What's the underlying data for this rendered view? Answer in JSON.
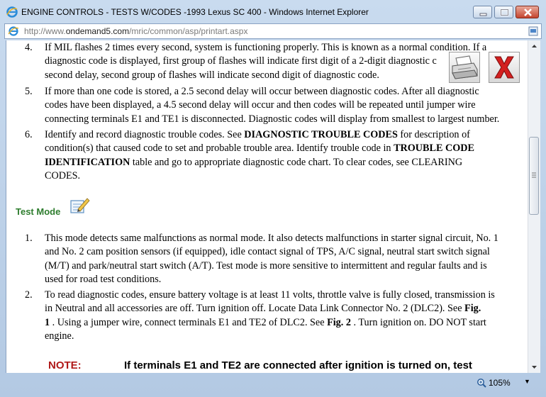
{
  "window": {
    "title": "ENGINE CONTROLS - TESTS W/CODES -1993 Lexus SC 400 - Windows Internet Explorer"
  },
  "address": {
    "prefix": "http://www.",
    "domain": "ondemand5.com",
    "path": "/mric/common/asp/printart.aspx"
  },
  "doc": {
    "items_top": [
      {
        "num": "4.",
        "lines": [
          "If MIL flashes 2 times every second, system is functioning properly. This is known as a normal condition. If a",
          "diagnostic code is displayed, first group of flashes will indicate first digit of a 2-digit diagnostic c",
          "second delay, second group of flashes will indicate second digit of diagnostic code."
        ]
      },
      {
        "num": "5.",
        "lines": [
          "If more than one code is stored, a 2.5 second delay will occur between diagnostic codes. After all diagnostic",
          "codes have been displayed, a 4.5 second delay will occur and then codes will be repeated until jumper wire",
          "connecting terminals E1 and TE1 is disconnected. Diagnostic codes will display from smallest to largest number."
        ]
      }
    ],
    "item6": {
      "num": "6.",
      "p1": "Identify and record diagnostic trouble codes. See ",
      "b1": "DIAGNOSTIC TROUBLE CODES",
      "p2": " for description of",
      "line2a": "condition(s) that caused code to set and probable trouble area. Identify trouble code in ",
      "b2": "TROUBLE CODE",
      "b3": "IDENTIFICATION",
      "line3": " table and go to appropriate diagnostic code chart. To clear codes, see CLEARING",
      "line4": "CODES."
    },
    "section_title": "Test Mode",
    "items_test": [
      {
        "num": "1.",
        "lines": [
          "This mode detects same malfunctions as normal mode. It also detects malfunctions in starter signal circuit, No. 1",
          "and No. 2 cam position sensors (if equipped), idle contact signal of TPS, A/C signal, neutral start switch signal",
          "(M/T) and park/neutral start switch (A/T). Test mode is more sensitive to intermittent and regular faults and is",
          "used for road test conditions."
        ]
      }
    ],
    "item2": {
      "num": "2.",
      "line1": "To read diagnostic codes, ensure battery voltage is at least 11 volts, throttle valve is fully closed, transmission is",
      "line2": "in Neutral and all accessories are off. Turn ignition off. Locate Data Link Connector No. 2 (DLC2). See ",
      "fig1": "Fig.",
      "fig1b": "1",
      "line3": " . Using a jumper wire, connect terminals E1 and TE2 of DLC2. See ",
      "fig2": "Fig. 2",
      "line3b": " . Turn ignition on. DO NOT start",
      "line4": "engine."
    },
    "note_label": "NOTE:",
    "note_text": "If terminals E1 and TE2 are connected after ignition is turned on, test"
  },
  "status": {
    "zoom": "105%"
  },
  "colors": {
    "section_green": "#2e7d2e",
    "note_red": "#b01818",
    "close_red": "#d42020"
  },
  "icons": [
    "ie-logo-icon",
    "page-icon",
    "feed-icon",
    "print-icon",
    "close-x-icon",
    "notepad-icon",
    "zoom-icon"
  ]
}
